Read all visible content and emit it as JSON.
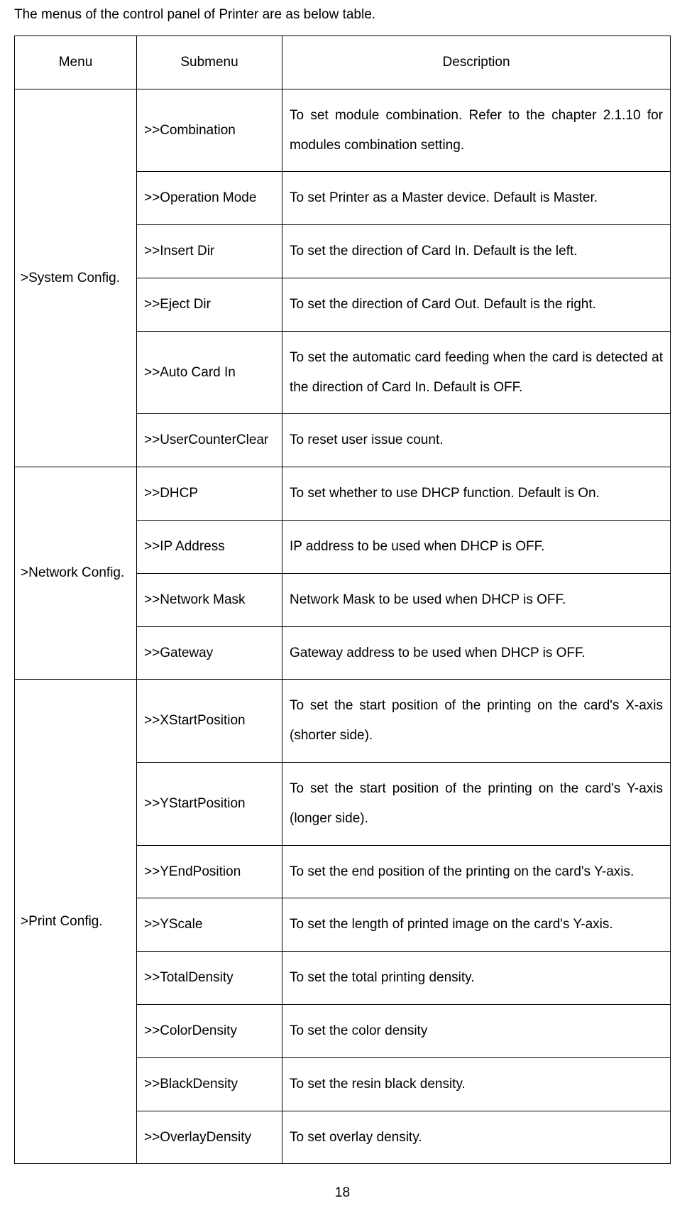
{
  "intro": "The menus of the control panel of Printer are as below table.",
  "headers": {
    "menu": "Menu",
    "submenu": "Submenu",
    "description": "Description"
  },
  "sections": [
    {
      "menu": ">System Config.",
      "rows": [
        {
          "submenu": ">>Combination",
          "desc": "To set module combination. Refer to the chapter 2.1.10 for modules combination setting."
        },
        {
          "submenu": ">>Operation Mode",
          "desc": "To set Printer as a Master device. Default is Master."
        },
        {
          "submenu": ">>Insert Dir",
          "desc": "To set the direction of Card In. Default is the left."
        },
        {
          "submenu": ">>Eject Dir",
          "desc": "To set the direction of Card Out. Default is the right."
        },
        {
          "submenu": ">>Auto Card In",
          "desc": "To set the automatic card feeding when the card is detected at the direction of Card In. Default is OFF."
        },
        {
          "submenu": ">>UserCounterClear",
          "desc": "To reset user issue count."
        }
      ]
    },
    {
      "menu": ">Network Config.",
      "rows": [
        {
          "submenu": ">>DHCP",
          "desc": "To set whether to use DHCP function. Default is On."
        },
        {
          "submenu": ">>IP Address",
          "desc": "IP address to be used when DHCP is OFF."
        },
        {
          "submenu": ">>Network Mask",
          "desc": "Network Mask to be used when DHCP is OFF."
        },
        {
          "submenu": ">>Gateway",
          "desc": "Gateway address to be used when DHCP is OFF."
        }
      ]
    },
    {
      "menu": ">Print Config.",
      "rows": [
        {
          "submenu": ">>XStartPosition",
          "desc": "To set the start position of the printing on the card's X-axis (shorter side)."
        },
        {
          "submenu": ">>YStartPosition",
          "desc": "To set the start position of the printing on the card's Y-axis (longer side)."
        },
        {
          "submenu": ">>YEndPosition",
          "desc": "To set the end position of the printing on the card's Y-axis."
        },
        {
          "submenu": ">>YScale",
          "desc": "To set the length of printed image on the card's Y-axis."
        },
        {
          "submenu": ">>TotalDensity",
          "desc": "To set the total printing density."
        },
        {
          "submenu": ">>ColorDensity",
          "desc": "To set the color density"
        },
        {
          "submenu": ">>BlackDensity",
          "desc": "To set the resin black density."
        },
        {
          "submenu": ">>OverlayDensity",
          "desc": "To set overlay density."
        }
      ]
    }
  ],
  "page_number": "18"
}
